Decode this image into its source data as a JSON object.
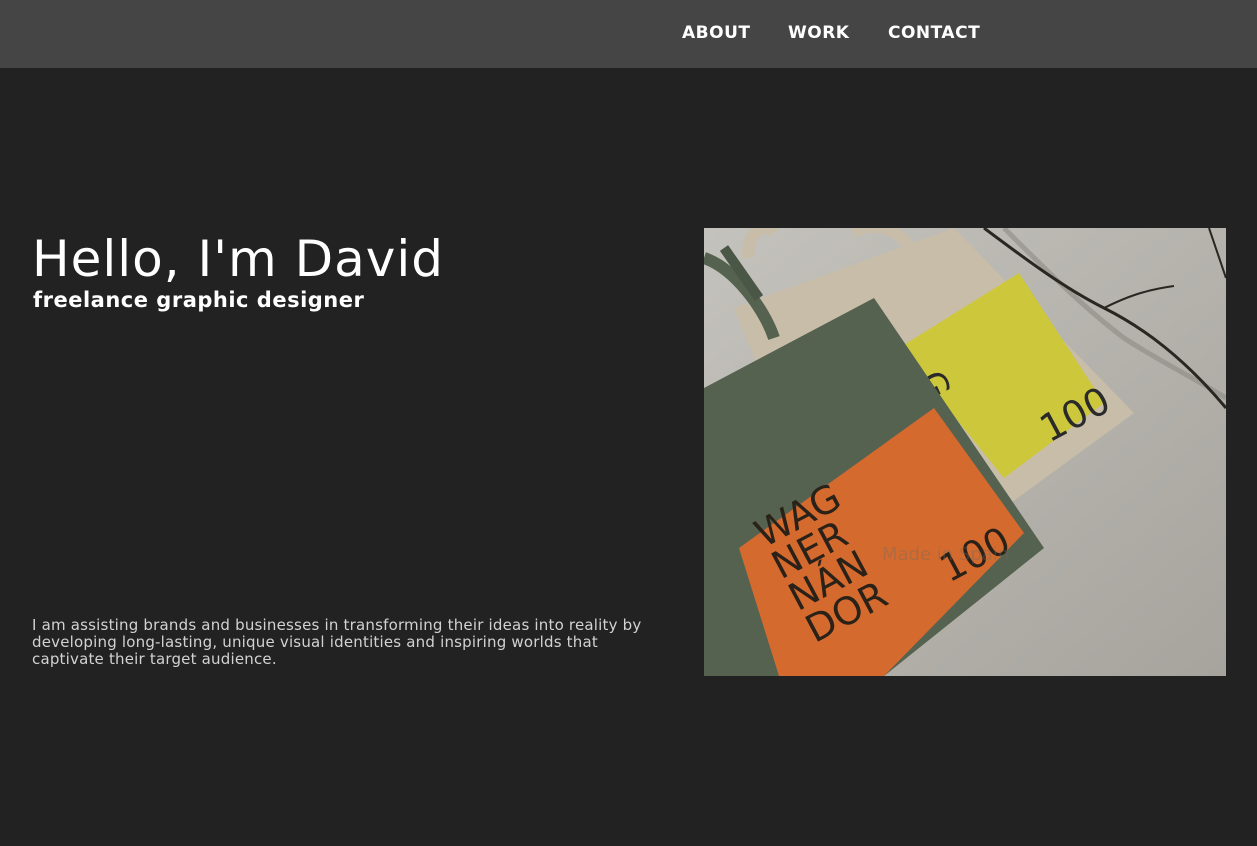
{
  "nav": {
    "items": [
      {
        "label": "ABOUT"
      },
      {
        "label": "WORK"
      },
      {
        "label": "CONTACT"
      }
    ]
  },
  "hero": {
    "title": "Hello, I'm David",
    "subtitle": "freelance graphic designer",
    "description": "I am assisting brands and businesses in transforming their ideas into reality by developing long-lasting, unique visual identities and inspiring worlds that captivate their target audience."
  },
  "image": {
    "back_bag": {
      "letters": "G\nRV\nR",
      "number": "100"
    },
    "front_bag": {
      "letters": "WAG\nNER\nNÁN\nDOR",
      "number": "100"
    },
    "watermark": "Made in Spain"
  },
  "colors": {
    "page_bg": "#222222",
    "navbar_bg": "#454545",
    "text": "#ffffff",
    "muted_text": "#d2d2d2",
    "orange": "#d46a2e",
    "yellow": "#cdc83b",
    "green_bag": "#55624f",
    "beige_bag": "#c8bda8"
  }
}
